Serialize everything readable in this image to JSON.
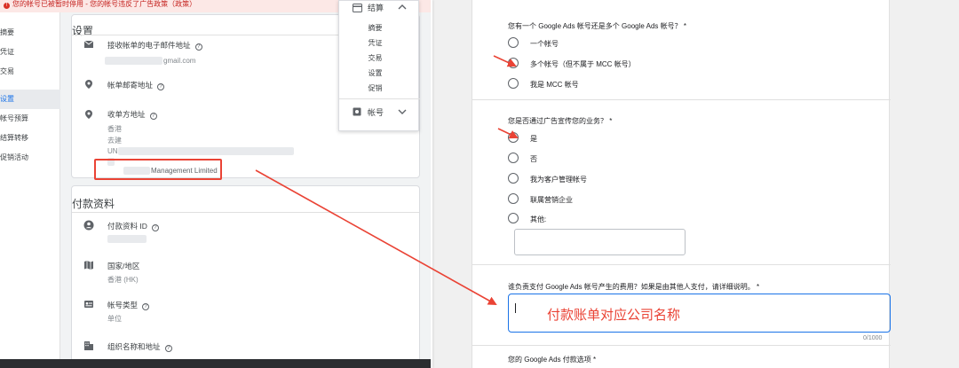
{
  "left": {
    "banner_text": "您的帐号已被暂时停用 - 您的帐号违反了广告政策（政策）",
    "nav": [
      {
        "label": "摘要"
      },
      {
        "label": "凭证"
      },
      {
        "label": "交易"
      },
      {
        "label": "设置"
      },
      {
        "label": "帐号预算"
      },
      {
        "label": "结算转移"
      },
      {
        "label": "促销活动"
      }
    ],
    "settings": {
      "title": "设置",
      "email_label": "接收帐单的电子邮件地址",
      "email_value": "gmail.com",
      "mailing_label": "帐单邮寄地址",
      "receiving_label": "收单方地址",
      "address_lines": [
        "香港",
        "去建",
        "UN"
      ],
      "company_fragment": "Management Limited"
    },
    "payment": {
      "title": "付款资料",
      "profile_id_label": "付款资料 ID",
      "country_label": "国家/地区",
      "country_value": "香港 (HK)",
      "account_type_label": "帐号类型",
      "account_type_value": "单位",
      "org_label": "组织名称和地址"
    },
    "menu": {
      "billing_label": "结算",
      "items": [
        "摘要",
        "凭证",
        "交易",
        "设置",
        "促销"
      ],
      "account_label": "帐号"
    }
  },
  "form": {
    "q1": {
      "title": "您有一个 Google Ads 帐号还是多个 Google Ads 帐号？ *",
      "options": [
        "一个帐号",
        "多个帐号（但不属于 MCC 帐号）",
        "我是 MCC 帐号"
      ]
    },
    "q2": {
      "title": "您是否通过广告宣传您的业务？ *",
      "options": [
        "是",
        "否",
        "我为客户管理帐号",
        "联属营销企业",
        "其他:"
      ]
    },
    "q3": {
      "title": "谁负责支付 Google Ads 帐号产生的费用？如果是由其他人支付，请详细说明。 *",
      "answer": "付款账单对应公司名称",
      "counter": "0/1000"
    },
    "q4": {
      "title": "您的 Google Ads 付款选项 *"
    }
  },
  "colors": {
    "annotation_red": "#ea4335",
    "accent_blue": "#1a73e8"
  }
}
